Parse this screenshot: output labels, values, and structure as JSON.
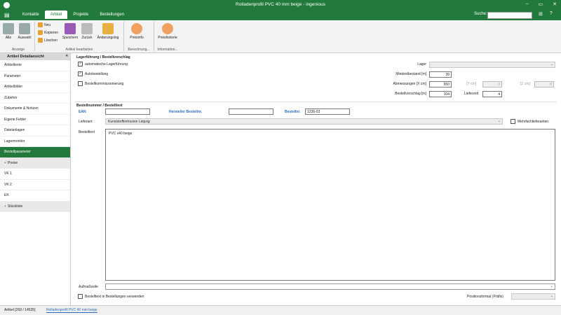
{
  "window": {
    "title": "Rolladenprofil PVC 40 mm beige - ingenious",
    "buttons": [
      "–",
      "▭",
      "✕"
    ]
  },
  "tabs": [
    "Kontakte",
    "Artikel",
    "Projekte",
    "Bestellungen"
  ],
  "search": {
    "label": "Suche:",
    "placeholder": ""
  },
  "toolbar_icons": [
    "⊞",
    "?"
  ],
  "ribbon": {
    "alle": "Alle",
    "auswahl": "Auswahl",
    "neu": "Neu",
    "kopieren": "Kopieren",
    "loeschen": "Löschen",
    "speichern": "Speichern",
    "zurueck": "Zurück",
    "aenderungslog": "Änderungslog",
    "preisinfo": "Preisinfo",
    "preishistorie": "Preishistorie",
    "groups": [
      "Anzeige",
      "Artikel bearbeiten",
      "Berechnung...",
      "Information..."
    ]
  },
  "sidebar": {
    "header": "Artikel Detailansicht",
    "items": [
      "Artikeltexte",
      "Parameter",
      "Artikelbilder",
      "Zubehör",
      "Dokumente & Notizen",
      "Eigene Felder",
      "Dateianlagen",
      "Lagermonitor",
      "Bestellparameter",
      "Preise",
      "VK 1",
      "VK 2",
      "EK",
      "Stückliste"
    ]
  },
  "lager": {
    "section": "Lagerführung / Bestellvorschlag",
    "auto_lager": "automatische Lagerführung",
    "autobestellung": "Autobestellung",
    "bestellkommissionierung": "Bestellkommissionierung",
    "lager_label": "Lager",
    "lager_value": "",
    "mindestbestand_label": "Mindestbestand [m]",
    "mindestbestand": "39",
    "abmessungen_label": "Abmessungen [X cm]",
    "abmessungen_x": "650",
    "y_label": "[Y cm]",
    "y_value": "0",
    "z_label": "[Z cm]",
    "z_value": "0",
    "bestellvorschlag_label": "Bestellvorschlag [m]",
    "bestellvorschlag": "104",
    "lieferzeit_label": "Lieferzeit",
    "lieferzeit": "4"
  },
  "bestell": {
    "section": "Bestellnummer / Bestelltext",
    "ean_label": "EAN",
    "ean": "",
    "herst_label": "Hersteller Bestellnr.",
    "herst": "",
    "bestellnr_label": "Bestellnr.",
    "bestellnr": "1236-03",
    "lieferant_label": "Lieferant",
    "lieferant": "Kunststoffextrusion Leipzig",
    "mehrfach": "Mehrfachlieferanten",
    "bestelltext_label": "Bestelltext",
    "bestelltext": "PVC x40 beige",
    "aufmass_label": "Aufmaßzeile",
    "aufmass": "",
    "verwenden": "Bestelltext in Bestellungen verwenden",
    "positionsformat_label": "Positionsformat (Präfix)",
    "positionsformat": ""
  },
  "status": {
    "count": "Artikel [269 / 14535]",
    "current": "Rolladenprofil PVC 40 mm beige"
  },
  "colors": {
    "accent": "#217a3c",
    "link": "#2a6ebb"
  }
}
